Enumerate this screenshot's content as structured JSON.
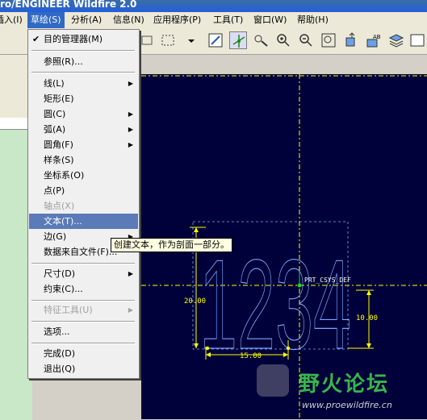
{
  "window": {
    "title": "ro/ENGINEER Wildfire 2.0"
  },
  "menubar": [
    {
      "label": "插入(I)",
      "active": false
    },
    {
      "label": "草绘(S)",
      "active": true
    },
    {
      "label": "分析(A)",
      "active": false
    },
    {
      "label": "信息(N)",
      "active": false
    },
    {
      "label": "应用程序(P)",
      "active": false
    },
    {
      "label": "工具(T)",
      "active": false
    },
    {
      "label": "窗口(W)",
      "active": false
    },
    {
      "label": "帮助(H)",
      "active": false
    }
  ],
  "sketch_menu": {
    "items": [
      {
        "label": "目的管理器(M)",
        "checked": true
      },
      {
        "label": "参照(R)..."
      },
      {
        "label": "线(L)",
        "submenu": true
      },
      {
        "label": "矩形(E)"
      },
      {
        "label": "圆(C)",
        "submenu": true
      },
      {
        "label": "弧(A)",
        "submenu": true
      },
      {
        "label": "圆角(F)",
        "submenu": true
      },
      {
        "label": "样条(S)"
      },
      {
        "label": "坐标系(O)"
      },
      {
        "label": "点(P)"
      },
      {
        "label": "轴点(X)",
        "disabled": true
      },
      {
        "label": "文本(T)...",
        "highlighted": true
      },
      {
        "label": "边(G)",
        "submenu": true
      },
      {
        "label": "数据来自文件(F)..."
      },
      {
        "label": "尺寸(D)",
        "submenu": true
      },
      {
        "label": "约束(C)..."
      },
      {
        "label": "特征工具(U)",
        "submenu": true,
        "disabled": true
      },
      {
        "label": "选项..."
      },
      {
        "label": "完成(D)"
      },
      {
        "label": "退出(Q)"
      }
    ]
  },
  "tooltip": "创建文本，作为剖面一部分。",
  "sketch": {
    "text": "1234",
    "csys_label": "PRT_CSYS_DEF",
    "dim_height": "20.00",
    "dim_width": "15.00",
    "dim_right": "10.00",
    "geometry_color": "#7aa7ff",
    "dimension_color": "#ffff00"
  },
  "watermark": {
    "name": "野火论坛",
    "url": "www.proewildfire.cn"
  }
}
